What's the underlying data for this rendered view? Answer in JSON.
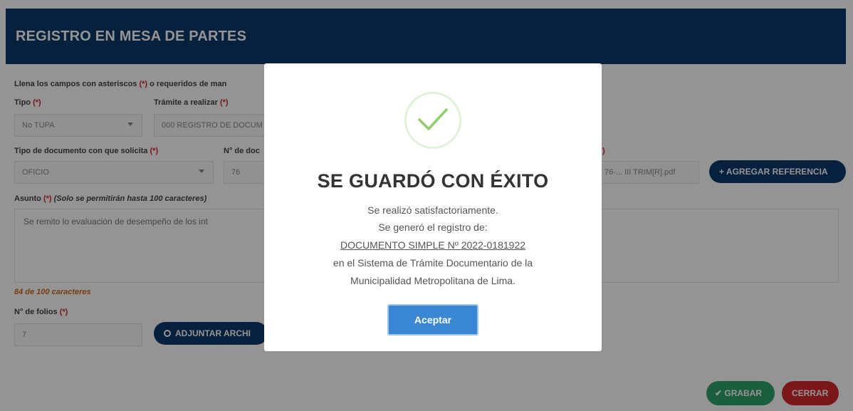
{
  "header": {
    "title": "REGISTRO EN MESA DE PARTES"
  },
  "form": {
    "instructions": "Llena los campos con asteriscos",
    "instructions_req": "(*)",
    "instructions_tail": "o requeridos de man",
    "required_mark": "(*)",
    "tipo": {
      "label": "Tipo",
      "value": "No TUPA"
    },
    "tramite": {
      "label": "Trámite a realizar",
      "value": "000 REGISTRO DE DOCUM"
    },
    "tipo_documento": {
      "label": "Tipo de documento con que solicita",
      "value": "OFICIO"
    },
    "num_documento": {
      "label": "N° de doc",
      "value": "76"
    },
    "archivo_value": "76-... III TRIM[R].pdf",
    "agregar_referencia_label": "+ AGREGAR REFERENCIA",
    "asunto": {
      "label": "Asunto",
      "note": "(Solo se permitirán hasta 100 caracteres)",
      "value": "Se remito lo evaluación de desempeño de los int"
    },
    "char_counter": "84 de 100 caracteres",
    "folios": {
      "label": "N° de folios",
      "value": "7"
    },
    "adjuntar_label": "ADJUNTAR ARCHI",
    "grabar_label": "✔ GRABAR",
    "cerrar_label": "CERRAR"
  },
  "modal": {
    "title": "SE GUARDÓ CON ÉXITO",
    "line1": "Se realizó satisfactoriamente.",
    "line2": "Se generó el registro de:",
    "line3": "DOCUMENTO SIMPLE Nº 2022-0181922",
    "line4": "en el Sistema de Trámite Documentario de la",
    "line5": "Municipalidad Metropolitana de Lima.",
    "accept_label": "Aceptar"
  },
  "colors": {
    "navy": "#0a3a6b",
    "success": "#2fa36b",
    "danger": "#d2282e",
    "accept": "#3a87d4"
  },
  "icons": [
    "check-icon",
    "search-icon",
    "caret-down-icon"
  ]
}
